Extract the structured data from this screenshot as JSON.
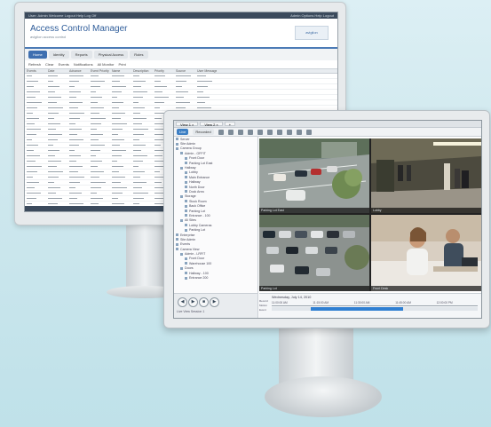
{
  "back_monitor": {
    "topbar_left": "User: Admin  Welcome  Logout  Help  Log Off",
    "topbar_right": "Admin  Options  Help  Logout",
    "title": "Access Control Manager",
    "subtitle": "avigilon access control",
    "logo_text": "avigilon",
    "tabs": [
      "Home",
      "Identity",
      "Reports",
      "Physical Access",
      "Roles"
    ],
    "active_tab": 0,
    "toolbar": [
      "Refresh",
      "Clear",
      "Events",
      "Notifications",
      "All Monitor",
      "Print"
    ],
    "columns": [
      "Events",
      "Date",
      "Advance",
      "Event Priority",
      "Name",
      "Description",
      "Priority",
      "Source",
      "User Message"
    ],
    "row_count": 27
  },
  "front_monitor": {
    "view_tabs": [
      "View 1 ×",
      "View 2 ×",
      "+"
    ],
    "toolbar": {
      "primary_button": "Live",
      "secondary_button": "Recorded"
    },
    "tree_items": [
      "Server",
      "Site Admin",
      "Camera Group",
      "  Admin - GFFIT",
      "    Front Door",
      "    Parking Lot East",
      "  Hallway",
      "    Lobby",
      "    Main Entrance",
      "    Hallway",
      "    North Door",
      "    Dock Area",
      "  Storage",
      "    Stock Room",
      "    Back Office",
      "    Parking Lot",
      "    Entrance - 100",
      "  All Sites",
      "    Lobby Cameras",
      "    Parking Lot",
      "Enterprise",
      "Site Admin",
      "Events",
      "Camera View",
      "  Admin - LRFIT",
      "    Front Door",
      "    Warehouse 100",
      "  Doors",
      "    Hallway - 100",
      "    Entrance 200"
    ],
    "control_label": "Live View Session 1",
    "camera_captions": [
      "Parking Lot East",
      "Lobby",
      "Parking Lot",
      "Front Desk"
    ],
    "timeline": {
      "date": "Wednesday, July 14, 2010",
      "ticks": [
        "11:00:00 AM",
        "11:15:00 AM",
        "11:30:00 AM",
        "11:45:00 AM",
        "12:00:00 PM"
      ],
      "row_labels": [
        "Record",
        "Motion",
        "Event"
      ],
      "selection_fraction": 0.45
    }
  }
}
